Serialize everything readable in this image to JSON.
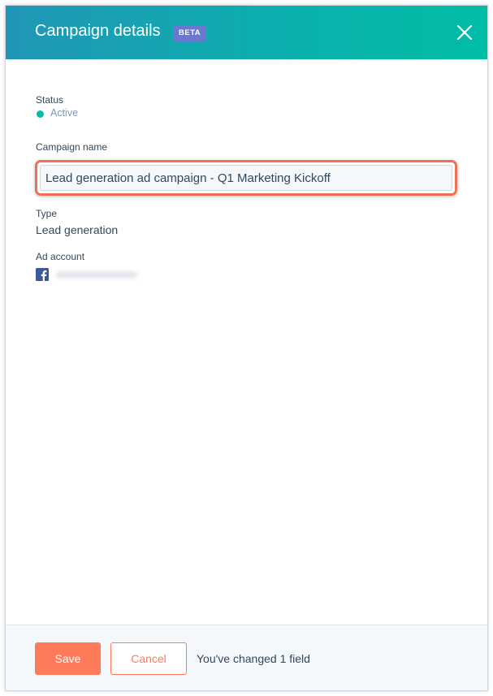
{
  "header": {
    "title": "Campaign details",
    "badge": "BETA",
    "close_icon": "close-icon"
  },
  "fields": {
    "status_label": "Status",
    "status_value": "Active",
    "status_color": "#00bda5",
    "campaign_name_label": "Campaign name",
    "campaign_name_value": "Lead generation ad campaign - Q1 Marketing Kickoff",
    "type_label": "Type",
    "type_value": "Lead generation",
    "ad_account_label": "Ad account",
    "ad_account_icon": "facebook-icon"
  },
  "footer": {
    "save_label": "Save",
    "cancel_label": "Cancel",
    "changed_message": "You've changed 1 field"
  },
  "colors": {
    "header_gradient_start": "#2196b6",
    "header_gradient_end": "#00bda5",
    "accent": "#ff7a59",
    "badge": "#6a78d1",
    "highlight": "#ee7156",
    "facebook": "#3b5998"
  }
}
